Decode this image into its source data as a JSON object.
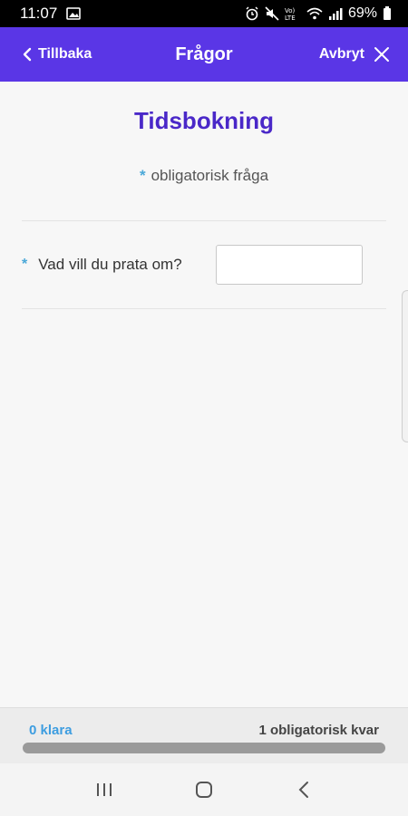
{
  "status_bar": {
    "time": "11:07",
    "battery": "69%",
    "icons": [
      "image-icon",
      "alarm-icon",
      "mute-icon",
      "volte-icon",
      "wifi-icon",
      "signal-icon",
      "battery-icon"
    ]
  },
  "nav": {
    "back_label": "Tillbaka",
    "title": "Frågor",
    "cancel_label": "Avbryt"
  },
  "form": {
    "title": "Tidsbokning",
    "required_marker": "*",
    "required_note": "obligatorisk fråga",
    "questions": [
      {
        "label": "Vad vill du prata om?",
        "value": "",
        "required": true
      }
    ]
  },
  "footer": {
    "done_text": "0 klara",
    "remaining_text": "1 obligatorisk kvar",
    "progress": 0
  },
  "colors": {
    "accent": "#5a36e6",
    "title": "#4a28c8",
    "asterisk": "#4aa8d8",
    "done": "#3d9de0"
  }
}
